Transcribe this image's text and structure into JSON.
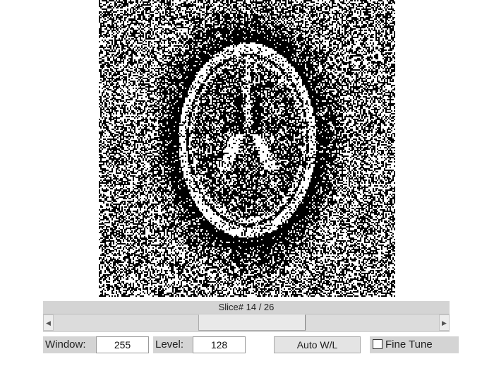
{
  "viewer": {
    "image_description_icon": "axial-brain-slice-icon"
  },
  "slice": {
    "label": "Slice# 14 / 26",
    "current": 14,
    "total": 26
  },
  "controls": {
    "window_label": "Window:",
    "window_value": "255",
    "level_label": "Level:",
    "level_value": "128",
    "auto_button": "Auto W/L",
    "fine_tune_label": "Fine Tune",
    "fine_tune_checked": false
  },
  "icons": {
    "left_arrow": "left-arrow-icon",
    "right_arrow": "right-arrow-icon"
  }
}
